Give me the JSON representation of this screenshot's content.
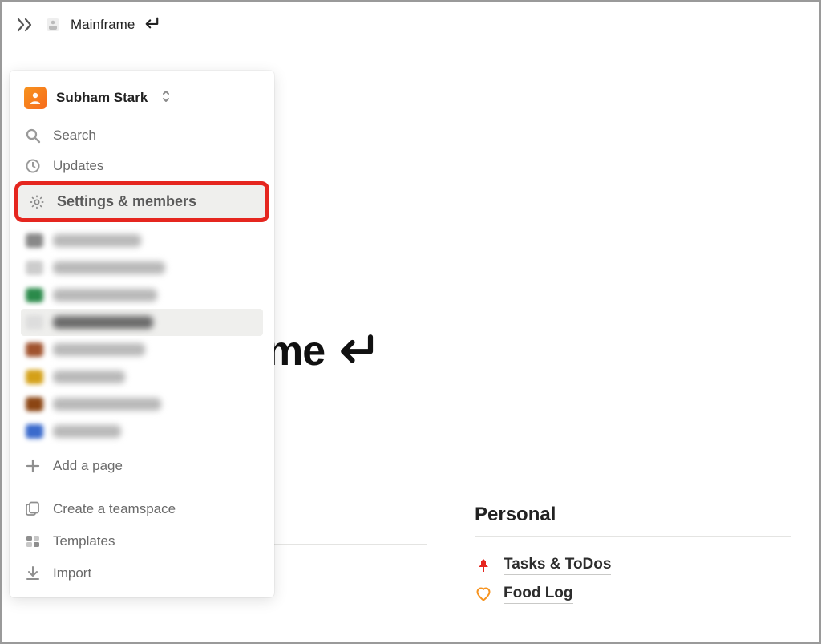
{
  "topbar": {
    "breadcrumb": "Mainframe"
  },
  "sidebar": {
    "workspace_name": "Subham Stark",
    "nav": {
      "search": "Search",
      "updates": "Updates",
      "settings": "Settings & members"
    },
    "add_page": "Add a page",
    "footer": {
      "teamspace": "Create a teamspace",
      "templates": "Templates",
      "import": "Import"
    }
  },
  "main": {
    "title_fragment": "me",
    "personal": {
      "heading": "Personal",
      "links": [
        {
          "label": "Tasks & ToDos"
        },
        {
          "label": "Food Log"
        }
      ]
    }
  }
}
